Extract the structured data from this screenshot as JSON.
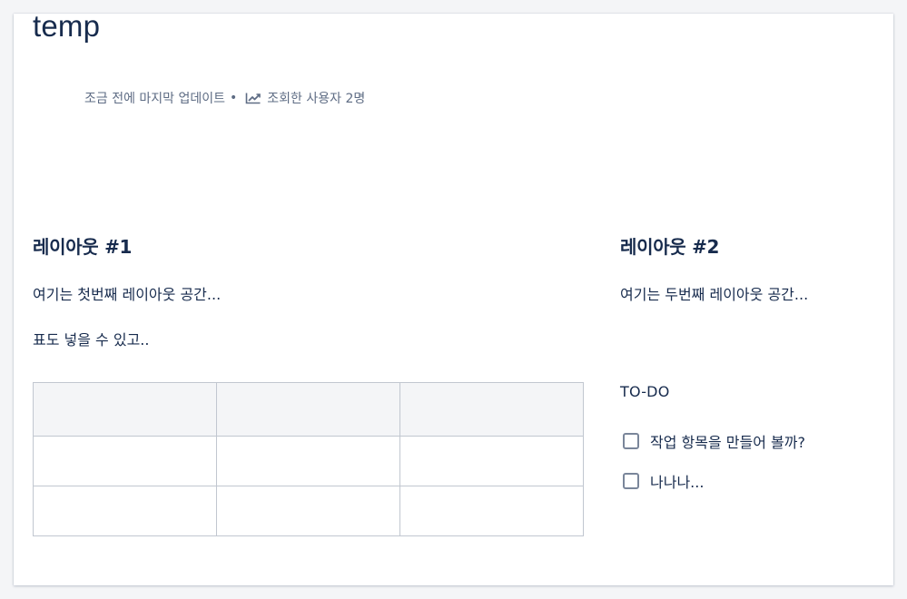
{
  "page": {
    "title": "temp",
    "meta": {
      "updated": "조금 전에 마지막 업데이트",
      "separator": "•",
      "trend_icon": "trending-up-icon",
      "viewers": "조회한 사용자 2명"
    }
  },
  "layout1": {
    "heading": "레이아웃 #1",
    "paragraph1": "여기는 첫번째 레이아웃 공간...",
    "paragraph2": "표도 넣을 수 있고..",
    "table": {
      "header": [
        "",
        "",
        ""
      ],
      "rows": [
        [
          "",
          "",
          ""
        ],
        [
          "",
          "",
          ""
        ]
      ]
    }
  },
  "layout2": {
    "heading": "레이아웃 #2",
    "paragraph1": "여기는 두번째 레이아웃 공간...",
    "todo_label": "TO-DO",
    "tasks": [
      {
        "label": "작업 항목을 만들어 볼까?",
        "checked": false
      },
      {
        "label": "나나나...",
        "checked": false
      }
    ]
  },
  "colors": {
    "text": "#172b4d",
    "meta_text": "#5e6c84",
    "table_border": "#c1c7d0",
    "table_header_bg": "#f4f5f7",
    "checkbox_border": "#7a869a"
  }
}
